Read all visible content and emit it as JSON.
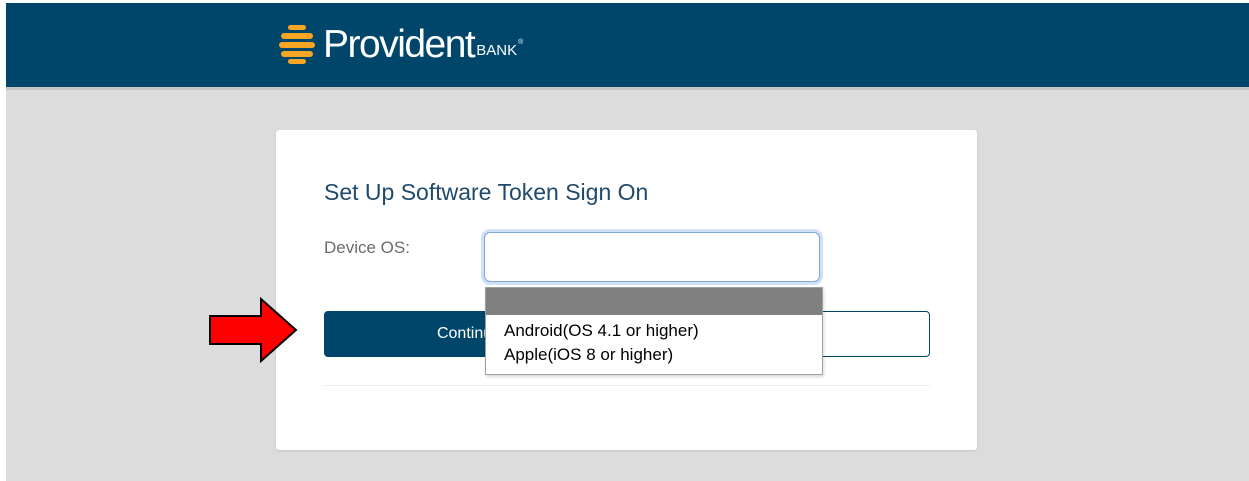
{
  "header": {
    "brand_name": "Provident",
    "brand_suffix": "BANK",
    "brand_reg": "®",
    "background": "#00466b",
    "logo_icon": "provident-stacked-bars-icon",
    "logo_color": "#f5a623"
  },
  "card": {
    "title": "Set Up Software Token Sign On",
    "device_os_label": "Device OS:",
    "device_os_value": "",
    "continue_label": "Continue",
    "cancel_label": ""
  },
  "dropdown": {
    "options": [
      "",
      "Android(OS 4.1 or higher)",
      "Apple(iOS 8 or higher)"
    ],
    "highlighted_index": 0
  },
  "annotation": {
    "icon": "red-arrow-icon",
    "color": "#ff0000"
  }
}
